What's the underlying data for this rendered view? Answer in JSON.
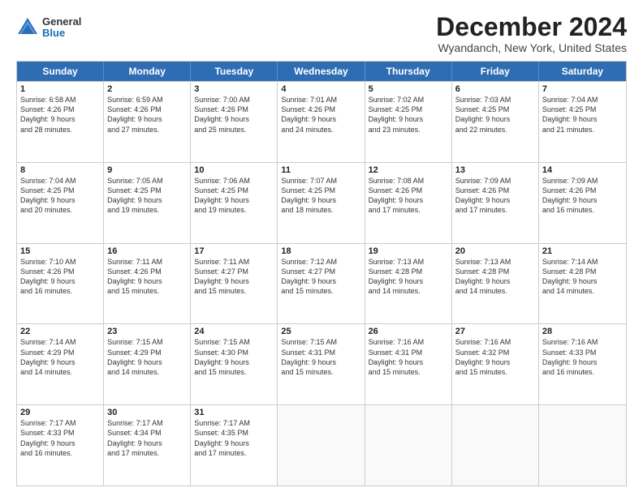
{
  "logo": {
    "general": "General",
    "blue": "Blue"
  },
  "title": {
    "month": "December 2024",
    "location": "Wyandanch, New York, United States"
  },
  "weekdays": [
    "Sunday",
    "Monday",
    "Tuesday",
    "Wednesday",
    "Thursday",
    "Friday",
    "Saturday"
  ],
  "weeks": [
    [
      {
        "day": "1",
        "lines": [
          "Sunrise: 6:58 AM",
          "Sunset: 4:26 PM",
          "Daylight: 9 hours",
          "and 28 minutes."
        ]
      },
      {
        "day": "2",
        "lines": [
          "Sunrise: 6:59 AM",
          "Sunset: 4:26 PM",
          "Daylight: 9 hours",
          "and 27 minutes."
        ]
      },
      {
        "day": "3",
        "lines": [
          "Sunrise: 7:00 AM",
          "Sunset: 4:26 PM",
          "Daylight: 9 hours",
          "and 25 minutes."
        ]
      },
      {
        "day": "4",
        "lines": [
          "Sunrise: 7:01 AM",
          "Sunset: 4:26 PM",
          "Daylight: 9 hours",
          "and 24 minutes."
        ]
      },
      {
        "day": "5",
        "lines": [
          "Sunrise: 7:02 AM",
          "Sunset: 4:25 PM",
          "Daylight: 9 hours",
          "and 23 minutes."
        ]
      },
      {
        "day": "6",
        "lines": [
          "Sunrise: 7:03 AM",
          "Sunset: 4:25 PM",
          "Daylight: 9 hours",
          "and 22 minutes."
        ]
      },
      {
        "day": "7",
        "lines": [
          "Sunrise: 7:04 AM",
          "Sunset: 4:25 PM",
          "Daylight: 9 hours",
          "and 21 minutes."
        ]
      }
    ],
    [
      {
        "day": "8",
        "lines": [
          "Sunrise: 7:04 AM",
          "Sunset: 4:25 PM",
          "Daylight: 9 hours",
          "and 20 minutes."
        ]
      },
      {
        "day": "9",
        "lines": [
          "Sunrise: 7:05 AM",
          "Sunset: 4:25 PM",
          "Daylight: 9 hours",
          "and 19 minutes."
        ]
      },
      {
        "day": "10",
        "lines": [
          "Sunrise: 7:06 AM",
          "Sunset: 4:25 PM",
          "Daylight: 9 hours",
          "and 19 minutes."
        ]
      },
      {
        "day": "11",
        "lines": [
          "Sunrise: 7:07 AM",
          "Sunset: 4:25 PM",
          "Daylight: 9 hours",
          "and 18 minutes."
        ]
      },
      {
        "day": "12",
        "lines": [
          "Sunrise: 7:08 AM",
          "Sunset: 4:26 PM",
          "Daylight: 9 hours",
          "and 17 minutes."
        ]
      },
      {
        "day": "13",
        "lines": [
          "Sunrise: 7:09 AM",
          "Sunset: 4:26 PM",
          "Daylight: 9 hours",
          "and 17 minutes."
        ]
      },
      {
        "day": "14",
        "lines": [
          "Sunrise: 7:09 AM",
          "Sunset: 4:26 PM",
          "Daylight: 9 hours",
          "and 16 minutes."
        ]
      }
    ],
    [
      {
        "day": "15",
        "lines": [
          "Sunrise: 7:10 AM",
          "Sunset: 4:26 PM",
          "Daylight: 9 hours",
          "and 16 minutes."
        ]
      },
      {
        "day": "16",
        "lines": [
          "Sunrise: 7:11 AM",
          "Sunset: 4:26 PM",
          "Daylight: 9 hours",
          "and 15 minutes."
        ]
      },
      {
        "day": "17",
        "lines": [
          "Sunrise: 7:11 AM",
          "Sunset: 4:27 PM",
          "Daylight: 9 hours",
          "and 15 minutes."
        ]
      },
      {
        "day": "18",
        "lines": [
          "Sunrise: 7:12 AM",
          "Sunset: 4:27 PM",
          "Daylight: 9 hours",
          "and 15 minutes."
        ]
      },
      {
        "day": "19",
        "lines": [
          "Sunrise: 7:13 AM",
          "Sunset: 4:28 PM",
          "Daylight: 9 hours",
          "and 14 minutes."
        ]
      },
      {
        "day": "20",
        "lines": [
          "Sunrise: 7:13 AM",
          "Sunset: 4:28 PM",
          "Daylight: 9 hours",
          "and 14 minutes."
        ]
      },
      {
        "day": "21",
        "lines": [
          "Sunrise: 7:14 AM",
          "Sunset: 4:28 PM",
          "Daylight: 9 hours",
          "and 14 minutes."
        ]
      }
    ],
    [
      {
        "day": "22",
        "lines": [
          "Sunrise: 7:14 AM",
          "Sunset: 4:29 PM",
          "Daylight: 9 hours",
          "and 14 minutes."
        ]
      },
      {
        "day": "23",
        "lines": [
          "Sunrise: 7:15 AM",
          "Sunset: 4:29 PM",
          "Daylight: 9 hours",
          "and 14 minutes."
        ]
      },
      {
        "day": "24",
        "lines": [
          "Sunrise: 7:15 AM",
          "Sunset: 4:30 PM",
          "Daylight: 9 hours",
          "and 15 minutes."
        ]
      },
      {
        "day": "25",
        "lines": [
          "Sunrise: 7:15 AM",
          "Sunset: 4:31 PM",
          "Daylight: 9 hours",
          "and 15 minutes."
        ]
      },
      {
        "day": "26",
        "lines": [
          "Sunrise: 7:16 AM",
          "Sunset: 4:31 PM",
          "Daylight: 9 hours",
          "and 15 minutes."
        ]
      },
      {
        "day": "27",
        "lines": [
          "Sunrise: 7:16 AM",
          "Sunset: 4:32 PM",
          "Daylight: 9 hours",
          "and 15 minutes."
        ]
      },
      {
        "day": "28",
        "lines": [
          "Sunrise: 7:16 AM",
          "Sunset: 4:33 PM",
          "Daylight: 9 hours",
          "and 16 minutes."
        ]
      }
    ],
    [
      {
        "day": "29",
        "lines": [
          "Sunrise: 7:17 AM",
          "Sunset: 4:33 PM",
          "Daylight: 9 hours",
          "and 16 minutes."
        ]
      },
      {
        "day": "30",
        "lines": [
          "Sunrise: 7:17 AM",
          "Sunset: 4:34 PM",
          "Daylight: 9 hours",
          "and 17 minutes."
        ]
      },
      {
        "day": "31",
        "lines": [
          "Sunrise: 7:17 AM",
          "Sunset: 4:35 PM",
          "Daylight: 9 hours",
          "and 17 minutes."
        ]
      },
      {
        "day": "",
        "lines": []
      },
      {
        "day": "",
        "lines": []
      },
      {
        "day": "",
        "lines": []
      },
      {
        "day": "",
        "lines": []
      }
    ]
  ]
}
